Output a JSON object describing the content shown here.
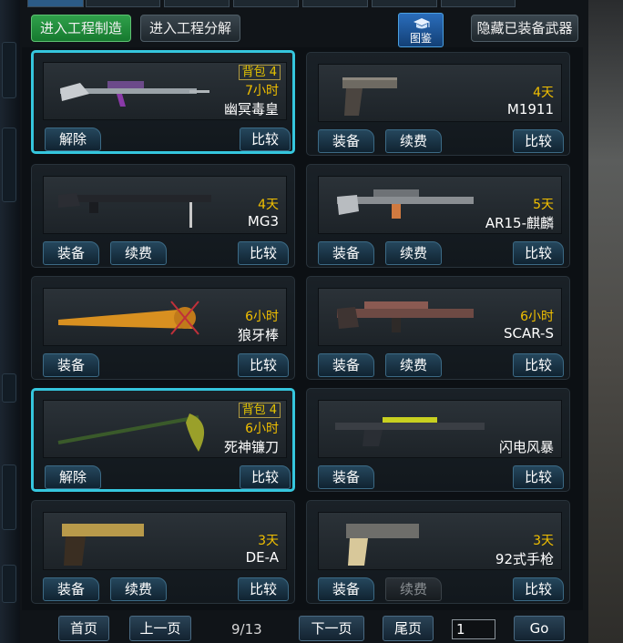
{
  "top_buttons": {
    "make": "进入工程制造",
    "decompose": "进入工程分解",
    "catalog": "图鉴",
    "hide": "隐藏已装备武器"
  },
  "cards": [
    {
      "name": "幽冥毒皇",
      "duration": "7小时",
      "bag": "背包 4",
      "selected": true,
      "buttons": [
        {
          "label": "解除"
        }
      ],
      "compare": "比较",
      "icon": "sniper-rifle-icon"
    },
    {
      "name": "M1911",
      "duration": "4天",
      "selected": false,
      "buttons": [
        {
          "label": "装备"
        },
        {
          "label": "续费"
        }
      ],
      "compare": "比较",
      "icon": "pistol-icon"
    },
    {
      "name": "MG3",
      "duration": "4天",
      "selected": false,
      "buttons": [
        {
          "label": "装备"
        },
        {
          "label": "续费"
        }
      ],
      "compare": "比较",
      "icon": "machine-gun-icon"
    },
    {
      "name": "AR15-麒麟",
      "duration": "5天",
      "selected": false,
      "buttons": [
        {
          "label": "装备"
        },
        {
          "label": "续费"
        }
      ],
      "compare": "比较",
      "icon": "assault-rifle-icon"
    },
    {
      "name": "狼牙棒",
      "duration": "6小时",
      "selected": false,
      "buttons": [
        {
          "label": "装备"
        }
      ],
      "compare": "比较",
      "icon": "spiked-bat-icon"
    },
    {
      "name": "SCAR-S",
      "duration": "6小时",
      "selected": false,
      "buttons": [
        {
          "label": "装备"
        },
        {
          "label": "续费"
        }
      ],
      "compare": "比较",
      "icon": "assault-rifle-icon"
    },
    {
      "name": "死神镰刀",
      "duration": "6小时",
      "bag": "背包 4",
      "selected": true,
      "buttons": [
        {
          "label": "解除"
        }
      ],
      "compare": "比较",
      "icon": "scythe-icon"
    },
    {
      "name": "闪电风暴",
      "duration": "",
      "selected": false,
      "buttons": [
        {
          "label": "装备"
        }
      ],
      "compare": "比较",
      "icon": "rifle-icon"
    },
    {
      "name": "DE-A",
      "duration": "3天",
      "selected": false,
      "buttons": [
        {
          "label": "装备"
        },
        {
          "label": "续费"
        }
      ],
      "compare": "比较",
      "icon": "pistol-icon"
    },
    {
      "name": "92式手枪",
      "duration": "3天",
      "selected": false,
      "buttons": [
        {
          "label": "装备"
        },
        {
          "label": "续费",
          "disabled": true
        }
      ],
      "compare": "比较",
      "icon": "pistol-icon"
    }
  ],
  "pager": {
    "first": "首页",
    "prev": "上一页",
    "info": "9/13",
    "next": "下一页",
    "last": "尾页",
    "input_value": "1",
    "go": "Go"
  },
  "colors": {
    "selected_border": "#35c6dd",
    "duration": "#f2c000",
    "green_button": "#2fa04a"
  }
}
